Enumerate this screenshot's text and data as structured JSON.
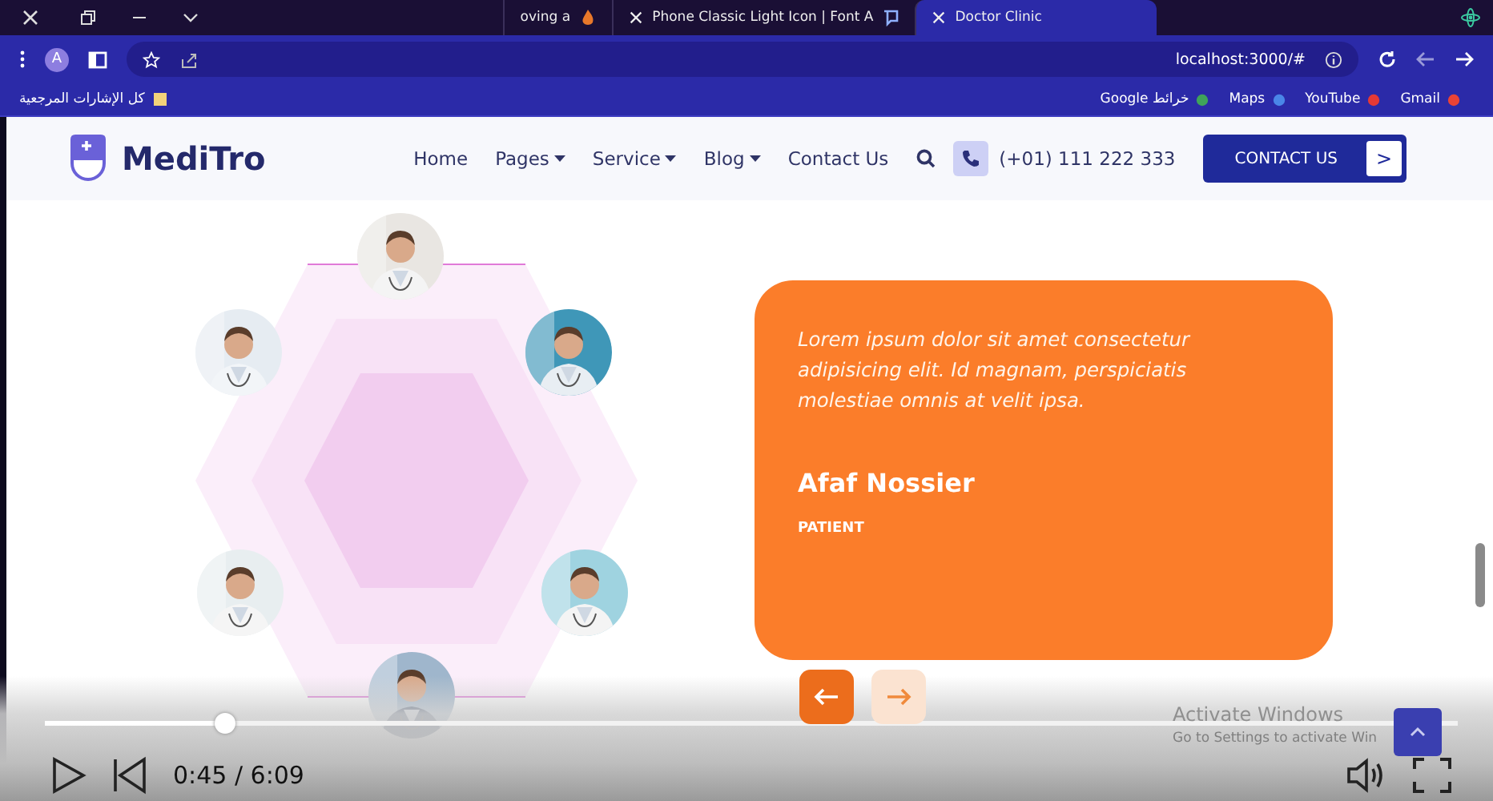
{
  "browser": {
    "tabs": [
      {
        "title": "oving a",
        "selected": false
      },
      {
        "title": "Phone Classic Light Icon | Font A",
        "selected": false
      },
      {
        "title": "Doctor Clinic",
        "selected": true
      }
    ],
    "profile_initial": "A",
    "address": "localhost:3000/#",
    "bookmarks_folder": "كل الإشارات المرجعية",
    "bookmarks": [
      {
        "label": "Google خرائط"
      },
      {
        "label": "Maps"
      },
      {
        "label": "YouTube"
      },
      {
        "label": "Gmail"
      }
    ]
  },
  "site": {
    "logo": "MediTro",
    "nav": [
      {
        "label": "Home",
        "dropdown": false
      },
      {
        "label": "Pages",
        "dropdown": true
      },
      {
        "label": "Service",
        "dropdown": true
      },
      {
        "label": "Blog",
        "dropdown": true
      },
      {
        "label": "Contact Us",
        "dropdown": false
      }
    ],
    "phone": "(+01) 111 222 333",
    "cta": {
      "label": "CONTACT US",
      "arrow": ">"
    }
  },
  "testimonial": {
    "quote": "Lorem ipsum dolor sit amet consectetur adipisicing elit. Id magnam, perspiciatis molestiae omnis at velit ipsa.",
    "name": "Afaf Nossier",
    "role": "PATIENT"
  },
  "os_notice": [
    "Activate Windows",
    "Go to Settings to activate Win"
  ],
  "slider_buttons": [
    {
      "kind": "prev",
      "selected": true
    },
    {
      "kind": "next",
      "selected": false
    }
  ],
  "player": {
    "level": 0.12,
    "time": "0:45 / 6:09"
  }
}
